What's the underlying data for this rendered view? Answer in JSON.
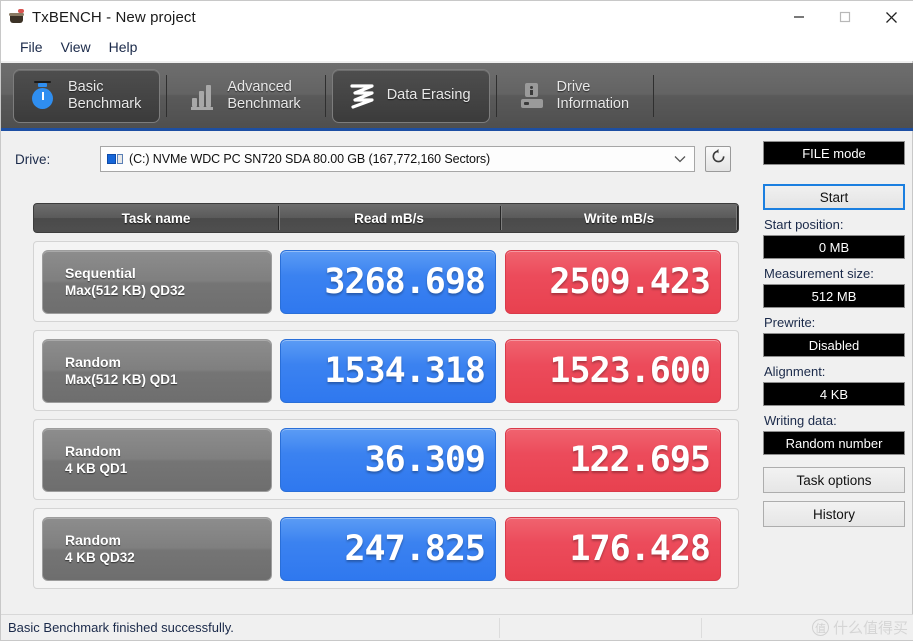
{
  "window": {
    "title": "TxBENCH - New project",
    "icon": "app-icon",
    "controls": {
      "minimize": "minimize",
      "maximize": "maximize",
      "close": "close"
    }
  },
  "menu": {
    "items": [
      "File",
      "View",
      "Help"
    ]
  },
  "tabs": [
    {
      "id": "basic-benchmark",
      "line1": "Basic",
      "line2": "Benchmark",
      "icon": "stopwatch-icon",
      "active": true
    },
    {
      "id": "advanced-benchmark",
      "line1": "Advanced",
      "line2": "Benchmark",
      "icon": "bar-chart-icon",
      "active": false
    },
    {
      "id": "data-erasing",
      "line1": "Data Erasing",
      "line2": "",
      "icon": "zigzag-icon",
      "active": true
    },
    {
      "id": "drive-information",
      "line1": "Drive",
      "line2": "Information",
      "icon": "drive-icon",
      "active": false
    }
  ],
  "drive": {
    "label": "Drive:",
    "selected": "(C:) NVMe WDC PC SN720 SDA  80.00 GB (167,772,160 Sectors)",
    "refresh_icon": "refresh-icon",
    "dropdown_icon": "chevron-down-icon"
  },
  "results": {
    "columns": [
      "Task name",
      "Read mB/s",
      "Write mB/s"
    ],
    "rows": [
      {
        "name_line1": "Sequential",
        "name_line2": "Max(512 KB) QD32",
        "read": "3268.698",
        "write": "2509.423"
      },
      {
        "name_line1": "Random",
        "name_line2": "Max(512 KB) QD1",
        "read": "1534.318",
        "write": "1523.600"
      },
      {
        "name_line1": "Random",
        "name_line2": "4 KB QD1",
        "read": "36.309",
        "write": "122.695"
      },
      {
        "name_line1": "Random",
        "name_line2": "4 KB QD32",
        "read": "247.825",
        "write": "176.428"
      }
    ]
  },
  "sidebar": {
    "mode_button": "FILE mode",
    "start_button": "Start",
    "start_position_label": "Start position:",
    "start_position_value": "0 MB",
    "measurement_size_label": "Measurement size:",
    "measurement_size_value": "512 MB",
    "prewrite_label": "Prewrite:",
    "prewrite_value": "Disabled",
    "alignment_label": "Alignment:",
    "alignment_value": "4 KB",
    "writing_data_label": "Writing data:",
    "writing_data_value": "Random number",
    "task_options_button": "Task options",
    "history_button": "History"
  },
  "statusbar": {
    "message": "Basic Benchmark finished successfully."
  },
  "watermark": {
    "mark": "值",
    "text": "什么值得买"
  },
  "colors": {
    "read_accent": "#3b82f0",
    "write_accent": "#ec4b5c",
    "tab_underline": "#1d4fa3",
    "start_focus": "#1b7fe0"
  },
  "chart_data": {
    "type": "bar",
    "title": "TxBENCH Basic Benchmark results",
    "categories": [
      "Sequential Max(512 KB) QD32",
      "Random Max(512 KB) QD1",
      "Random 4 KB QD1",
      "Random 4 KB QD32"
    ],
    "series": [
      {
        "name": "Read mB/s",
        "values": [
          3268.698,
          1534.318,
          36.309,
          247.825
        ]
      },
      {
        "name": "Write mB/s",
        "values": [
          2509.423,
          1523.6,
          122.695,
          176.428
        ]
      }
    ],
    "xlabel": "Task name",
    "ylabel": "mB/s",
    "legend": [
      "Read mB/s",
      "Write mB/s"
    ]
  }
}
